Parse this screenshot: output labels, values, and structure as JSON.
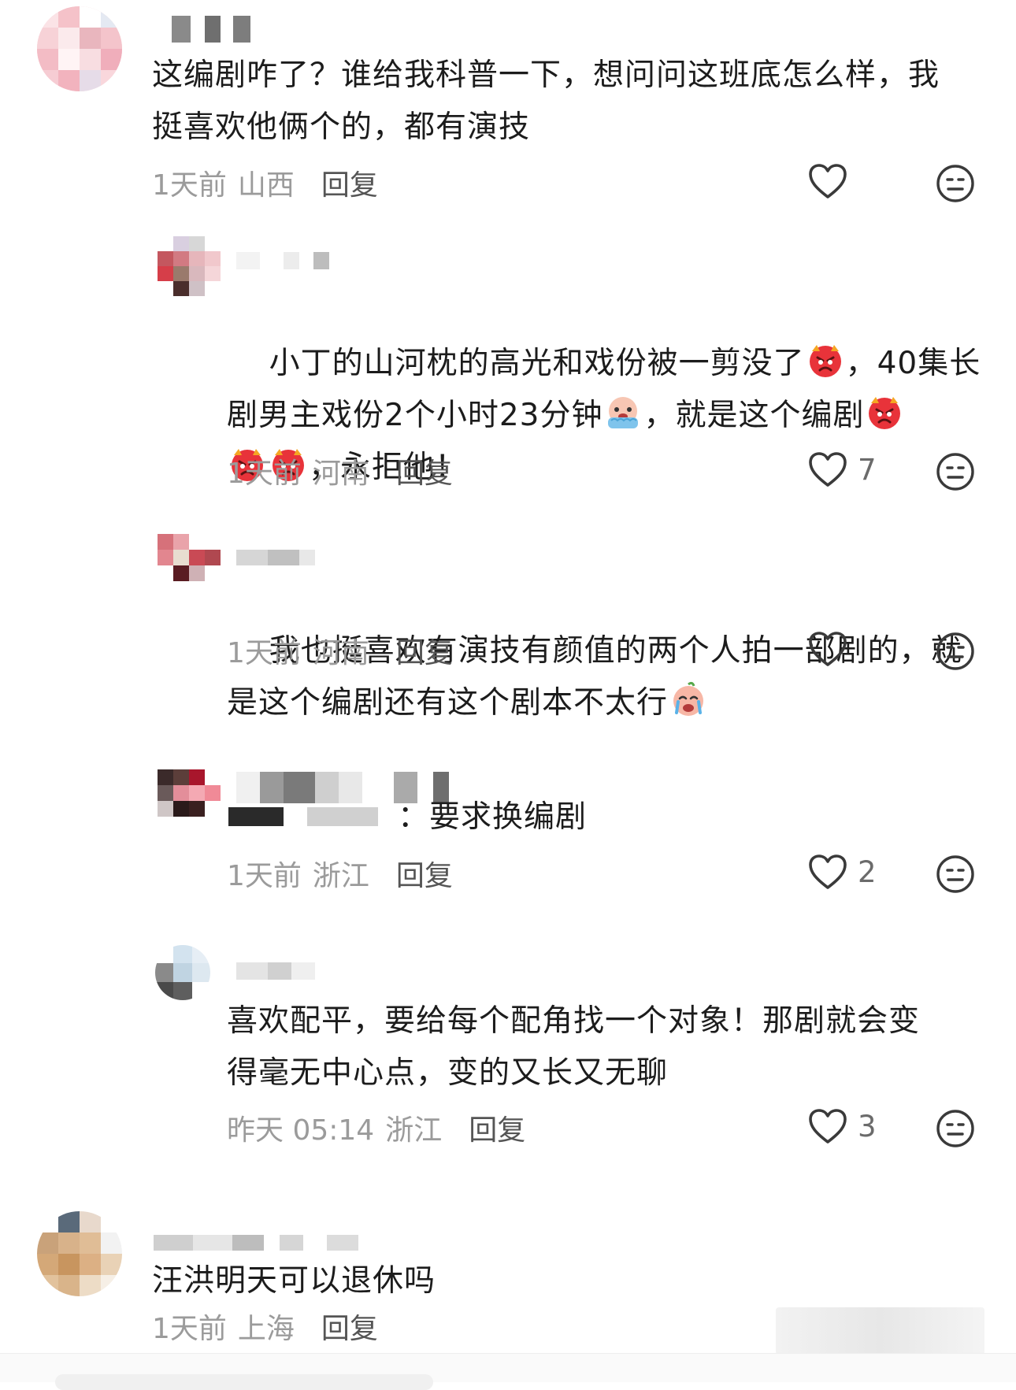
{
  "comments": [
    {
      "text": "这编剧咋了？谁给我科普一下，想问问这班底怎么样，我\n挺喜欢他俩个的，都有演技",
      "time": "1天前",
      "location": "山西",
      "reply_label": "回复",
      "likes": ""
    },
    {
      "text_parts": [
        "小丁的山河枕的高光和戏份被一剪没了",
        "，40集长\n剧男主戏份2个小时23分钟",
        "，就是这个编剧",
        "\n",
        "",
        "，永拒他！"
      ],
      "time": "1天前",
      "location": "河南",
      "reply_label": "回复",
      "likes": "7"
    },
    {
      "text_parts": [
        "我也挺喜欢有演技有颜值的两个人拍一部剧的，就\n是这个编剧还有这个剧本不太行"
      ],
      "time": "1天前",
      "location": "河南",
      "reply_label": "回复",
      "likes": ""
    },
    {
      "text": "：要求换编剧",
      "time": "1天前",
      "location": "浙江",
      "reply_label": "回复",
      "likes": "2"
    },
    {
      "text": "喜欢配平，要给每个配角找一个对象！那剧就会变\n得毫无中心点，变的又长又无聊",
      "time": "昨天 05:14",
      "location": "浙江",
      "reply_label": "回复",
      "likes": "3"
    },
    {
      "text": "汪洪明天可以退休吗",
      "time": "1天前",
      "location": "上海",
      "reply_label": "回复",
      "likes": ""
    }
  ],
  "icons": {
    "like": "heart-outline-icon",
    "dislike": "neutral-face-icon",
    "emoji_angry": "angry-devil-emoji",
    "emoji_crying": "crying-emoji"
  },
  "colors": {
    "text": "#1c1c1c",
    "meta": "#9b9b9b",
    "reply": "#555555",
    "icon": "#3a3a3a"
  }
}
